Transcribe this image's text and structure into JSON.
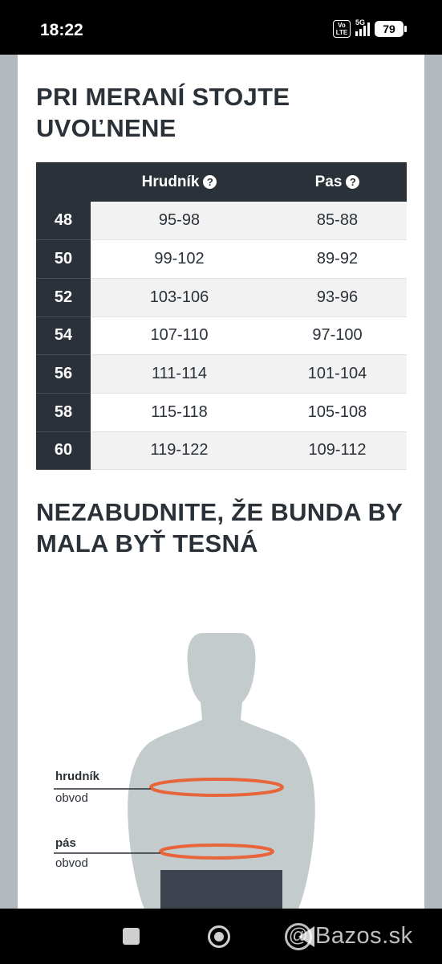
{
  "status_bar": {
    "time": "18:22",
    "volte": "Vo LTE",
    "network": "5G",
    "battery": "79"
  },
  "page": {
    "heading1": "PRI MERANÍ STOJTE UVOĽNENE",
    "table": {
      "columns": [
        "Hrudník",
        "Pas"
      ],
      "help_icon": "question-circle-icon",
      "rows": [
        {
          "size": "48",
          "chest": "95-98",
          "waist": "85-88"
        },
        {
          "size": "50",
          "chest": "99-102",
          "waist": "89-92"
        },
        {
          "size": "52",
          "chest": "103-106",
          "waist": "93-96"
        },
        {
          "size": "54",
          "chest": "107-110",
          "waist": "97-100"
        },
        {
          "size": "56",
          "chest": "111-114",
          "waist": "101-104"
        },
        {
          "size": "58",
          "chest": "115-118",
          "waist": "105-108"
        },
        {
          "size": "60",
          "chest": "119-122",
          "waist": "109-112"
        }
      ]
    },
    "heading2": "NEZABUDNITE, ŽE BUNDA BY MALA BYŤ TESNÁ",
    "figure": {
      "chest_label": "hrudník",
      "chest_sub": "obvod",
      "waist_label": "pás",
      "waist_sub": "obvod",
      "body_color": "#c3cbcc",
      "measure_color": "#e8643a"
    }
  },
  "watermark": "Bazos.sk"
}
